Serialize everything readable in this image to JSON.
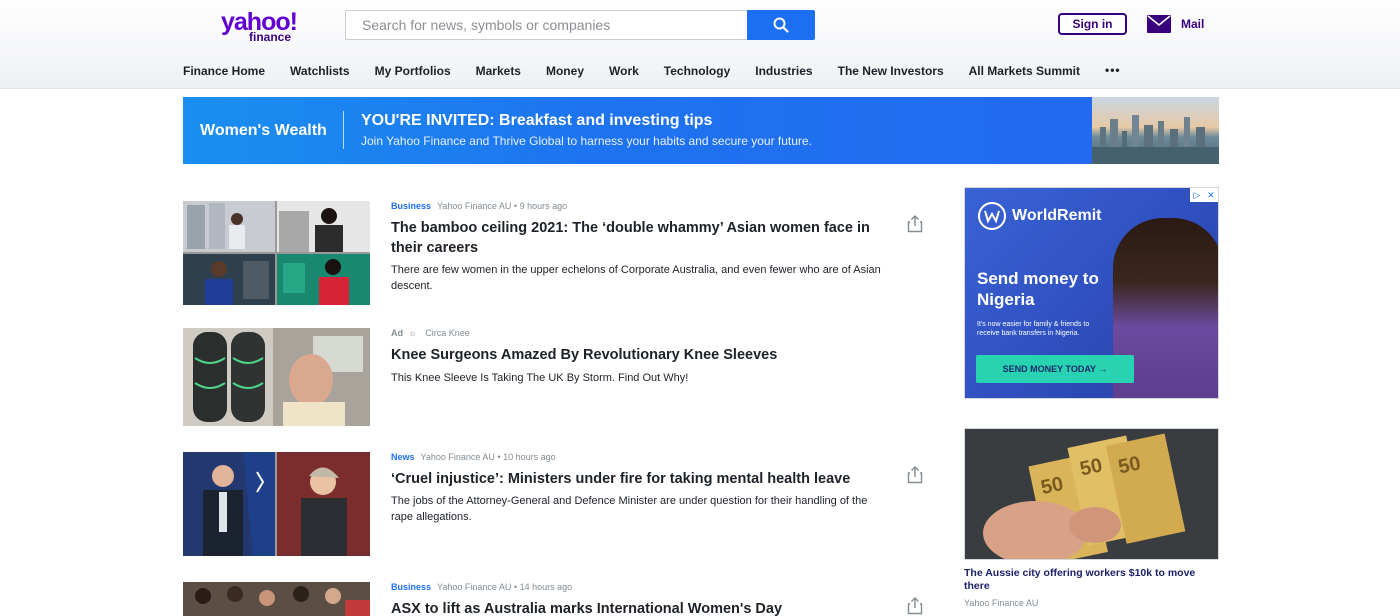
{
  "header": {
    "logo_top": "yahoo!",
    "logo_bottom": "finance",
    "search_placeholder": "Search for news, symbols or companies",
    "signin_label": "Sign in",
    "mail_label": "Mail",
    "brand_color": "#6001d2",
    "accent_color": "#1d6ff2"
  },
  "nav": {
    "items": [
      "Finance Home",
      "Watchlists",
      "My Portfolios",
      "Markets",
      "Money",
      "Work",
      "Technology",
      "Industries",
      "The New Investors",
      "All Markets Summit"
    ],
    "more": "•••"
  },
  "banner": {
    "brand": "Women's Wealth",
    "title": "YOU'RE INVITED: Breakfast and investing tips",
    "subtitle": "Join Yahoo Finance and Thrive Global to harness your habits and secure your future."
  },
  "stories": [
    {
      "category": "Business",
      "source": "Yahoo Finance AU",
      "time": "9 hours ago",
      "headline": "The bamboo ceiling 2021: The ‘double whammy’ Asian women face in their careers",
      "summary": "There are few women in the upper echelons of Corporate Australia, and even fewer who are of Asian descent."
    },
    {
      "ad_label": "Ad",
      "source": "Circa Knee",
      "headline": "Knee Surgeons Amazed By Revolutionary Knee Sleeves",
      "summary": "This Knee Sleeve Is Taking The UK By Storm. Find Out Why!"
    },
    {
      "category": "News",
      "source": "Yahoo Finance AU",
      "time": "10 hours ago",
      "headline": "‘Cruel injustice’: Ministers under fire for taking mental health leave",
      "summary": "The jobs of the Attorney-General and Defence Minister are under question for their handling of the rape allegations."
    },
    {
      "category": "Business",
      "source": "Yahoo Finance AU",
      "time": "14 hours ago",
      "headline": "ASX to lift as Australia marks International Women's Day"
    }
  ],
  "sidebar_ad": {
    "brand": "WorldRemit",
    "headline": "Send money to Nigeria",
    "small_text": "It's now easier for family & friends to receive bank transfers in Nigeria.",
    "cta": "SEND MONEY TODAY →"
  },
  "sidebar_story": {
    "title": "The Aussie city offering workers $10k to move there",
    "source": "Yahoo Finance AU"
  }
}
